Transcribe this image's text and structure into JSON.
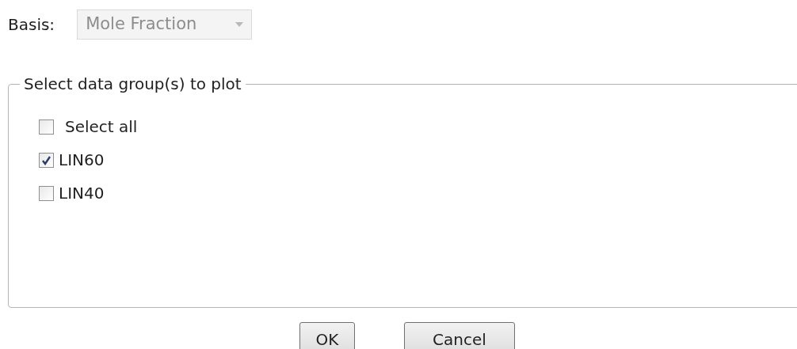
{
  "basis": {
    "label": "Basis:",
    "value": "Mole Fraction",
    "disabled": true
  },
  "group": {
    "legend": "Select data group(s) to plot",
    "items": [
      {
        "label": "Select all",
        "checked": false
      },
      {
        "label": "LIN60",
        "checked": true
      },
      {
        "label": "LIN40",
        "checked": false
      }
    ]
  },
  "buttons": [
    "OK",
    "Cancel"
  ]
}
